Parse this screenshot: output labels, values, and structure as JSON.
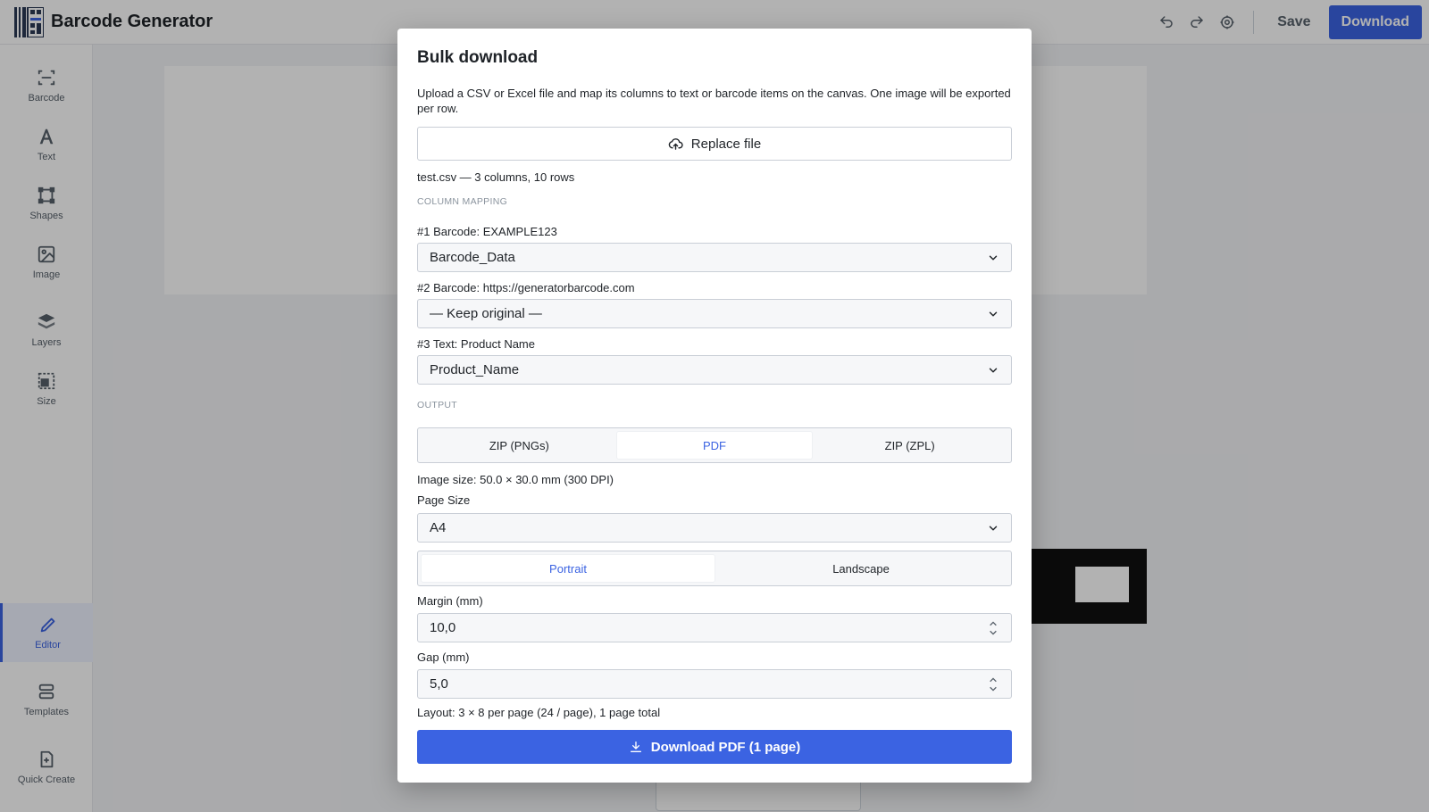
{
  "app": {
    "title": "Barcode Generator",
    "accent_color": "#3b63e2"
  },
  "toolbar": {
    "undo_icon": "undo-icon",
    "redo_icon": "redo-icon",
    "settings_icon": "gear-icon",
    "save_label": "Save",
    "download_label": "Download"
  },
  "sidebar": {
    "items": [
      {
        "label": "Barcode",
        "icon": "barcode-scan-icon"
      },
      {
        "label": "Text",
        "icon": "text-icon"
      },
      {
        "label": "Shapes",
        "icon": "shapes-icon"
      },
      {
        "label": "Image",
        "icon": "image-icon"
      },
      {
        "label": "Layers",
        "icon": "layers-icon"
      },
      {
        "label": "Size",
        "icon": "size-icon"
      },
      {
        "label": "Editor",
        "icon": "pencil-icon",
        "active": true
      },
      {
        "label": "Templates",
        "icon": "templates-icon"
      },
      {
        "label": "Quick Create",
        "icon": "quick-create-icon"
      }
    ]
  },
  "modal": {
    "title": "Bulk download",
    "description": "Upload a CSV or Excel file and map its columns to text or barcode items on the canvas. One image will be exported per row.",
    "replace_file_label": "Replace file",
    "file_info": "test.csv — 3 columns, 10 rows",
    "column_mapping_heading": "COLUMN MAPPING",
    "mappings": [
      {
        "label": "#1 Barcode: EXAMPLE123",
        "value": "Barcode_Data"
      },
      {
        "label": "#2 Barcode: https://generatorbarcode.com",
        "value": "— Keep original —"
      },
      {
        "label": "#3 Text: Product Name",
        "value": "Product_Name"
      }
    ],
    "output_heading": "OUTPUT",
    "output_formats": [
      "ZIP (PNGs)",
      "PDF",
      "ZIP (ZPL)"
    ],
    "output_selected": "PDF",
    "image_size": "Image size: 50.0 × 30.0 mm (300 DPI)",
    "page_size_label": "Page Size",
    "page_size_value": "A4",
    "orientations": [
      "Portrait",
      "Landscape"
    ],
    "orientation_selected": "Portrait",
    "margin_label": "Margin (mm)",
    "margin_value": "10,0",
    "gap_label": "Gap (mm)",
    "gap_value": "5,0",
    "layout_info": "Layout: 3 × 8 per page (24 / page), 1 page total",
    "download_button_label": "Download PDF (1 page)"
  }
}
